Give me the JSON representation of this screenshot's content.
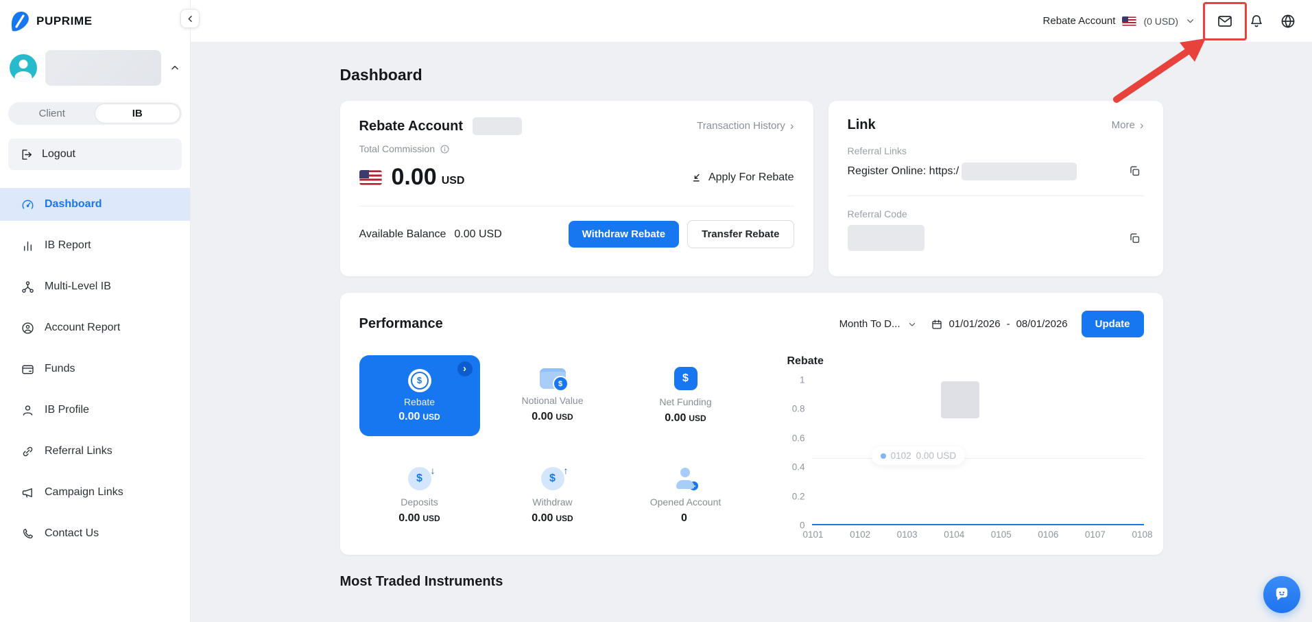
{
  "colors": {
    "primary": "#1777F0",
    "annotation": "#E8423C"
  },
  "brand": {
    "name": "PUPRIME"
  },
  "topbar": {
    "account_label": "Rebate Account",
    "balance": "(0 USD)"
  },
  "sidebar": {
    "tabs": {
      "client": "Client",
      "ib": "IB"
    },
    "logout": "Logout",
    "items": [
      {
        "label": "Dashboard",
        "active": true
      },
      {
        "label": "IB Report"
      },
      {
        "label": "Multi-Level IB"
      },
      {
        "label": "Account Report"
      },
      {
        "label": "Funds"
      },
      {
        "label": "IB Profile"
      },
      {
        "label": "Referral Links"
      },
      {
        "label": "Campaign Links"
      },
      {
        "label": "Contact Us"
      }
    ]
  },
  "page": {
    "title": "Dashboard"
  },
  "rebate_card": {
    "title": "Rebate Account",
    "transaction_history": "Transaction History",
    "total_commission_label": "Total Commission",
    "amount": "0.00",
    "currency": "USD",
    "apply_label": "Apply For Rebate",
    "available_balance_label": "Available Balance",
    "available_balance_value": "0.00 USD",
    "withdraw_label": "Withdraw Rebate",
    "transfer_label": "Transfer Rebate"
  },
  "link_card": {
    "title": "Link",
    "more": "More",
    "referral_links_label": "Referral Links",
    "register_text": "Register Online: https:/",
    "referral_code_label": "Referral Code"
  },
  "performance": {
    "title": "Performance",
    "range_dropdown": "Month To D...",
    "date_start": "01/01/2026",
    "date_separator": "-",
    "date_end": "08/01/2026",
    "update_label": "Update",
    "tiles": [
      {
        "label": "Rebate",
        "value": "0.00",
        "unit": "USD",
        "active": true
      },
      {
        "label": "Notional Value",
        "value": "0.00",
        "unit": "USD"
      },
      {
        "label": "Net Funding",
        "value": "0.00",
        "unit": "USD"
      },
      {
        "label": "Deposits",
        "value": "0.00",
        "unit": "USD"
      },
      {
        "label": "Withdraw",
        "value": "0.00",
        "unit": "USD"
      },
      {
        "label": "Opened Account",
        "value": "0",
        "unit": ""
      }
    ]
  },
  "chart_data": {
    "type": "line",
    "title": "Rebate",
    "x": [
      "0101",
      "0102",
      "0103",
      "0104",
      "0105",
      "0106",
      "0107",
      "0108"
    ],
    "values": [
      0,
      0,
      0,
      0,
      0,
      0,
      0,
      0
    ],
    "ylim": [
      0,
      1
    ],
    "yticks": [
      "1",
      "0.8",
      "0.6",
      "0.4",
      "0.2",
      "0"
    ],
    "grid": false,
    "legend": false,
    "line_color": "#1777F0",
    "tooltip": {
      "x": "0102",
      "value": "0.00 USD"
    }
  },
  "sections": {
    "most_traded": "Most Traded Instruments"
  },
  "icons": [
    "chevron-left",
    "chevron-up",
    "chevron-down",
    "chevron-right",
    "mail",
    "bell",
    "globe",
    "us-flag",
    "info",
    "calendar",
    "copy",
    "logout",
    "gauge",
    "bar-chart",
    "network",
    "person-circle",
    "bank-card",
    "person",
    "link",
    "megaphone",
    "phone",
    "coin-dollar",
    "wallet-dollar",
    "card-dollar",
    "deposit-dollar",
    "withdraw-dollar",
    "person-plus",
    "chat-bubble"
  ],
  "redacted_fields": [
    "username",
    "rebate-account-number",
    "referral-url",
    "referral-code",
    "chart-hover-area"
  ],
  "annotation": {
    "type": "box-and-arrow",
    "target": "mail-icon",
    "color": "#E8423C"
  }
}
